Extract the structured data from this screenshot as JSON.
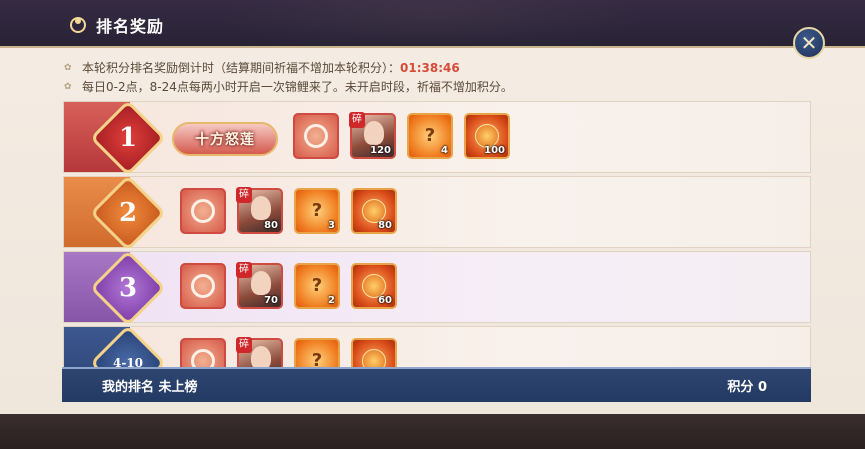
{
  "header": {
    "title": "排名奖励"
  },
  "notes": [
    {
      "text": "本轮积分排名奖励倒计时（结算期间祈福不增加本轮积分）：",
      "timer": "01:38:46"
    },
    {
      "text": "每日0-2点，8-24点每两小时开启一次锦鲤来了。未开启时段，祈福不增加积分。"
    }
  ],
  "rows": [
    {
      "rank": "1",
      "title_badge": "十方怒莲",
      "items": [
        {
          "type": "frame-icon",
          "qty": ""
        },
        {
          "type": "character-shard-icon",
          "tag": "碎",
          "qty": "120"
        },
        {
          "type": "question-orb-icon",
          "qty": "4"
        },
        {
          "type": "fire-coin-icon",
          "qty": "100"
        }
      ]
    },
    {
      "rank": "2",
      "items": [
        {
          "type": "frame-icon",
          "qty": ""
        },
        {
          "type": "character-shard-icon",
          "tag": "碎",
          "qty": "80"
        },
        {
          "type": "question-orb-icon",
          "qty": "3"
        },
        {
          "type": "fire-coin-icon",
          "qty": "80"
        }
      ]
    },
    {
      "rank": "3",
      "items": [
        {
          "type": "frame-icon",
          "qty": ""
        },
        {
          "type": "character-shard-icon",
          "tag": "碎",
          "qty": "70"
        },
        {
          "type": "question-orb-icon",
          "qty": "2"
        },
        {
          "type": "fire-coin-icon",
          "qty": "60"
        }
      ]
    },
    {
      "rank": "4-10",
      "items": [
        {
          "type": "frame-icon",
          "qty": ""
        },
        {
          "type": "character-shard-icon",
          "tag": "碎",
          "qty": ""
        },
        {
          "type": "question-orb-icon",
          "qty": ""
        },
        {
          "type": "fire-coin-icon",
          "qty": ""
        }
      ]
    }
  ],
  "footer": {
    "my_rank": "我的排名 未上榜",
    "score": "积分 0"
  }
}
